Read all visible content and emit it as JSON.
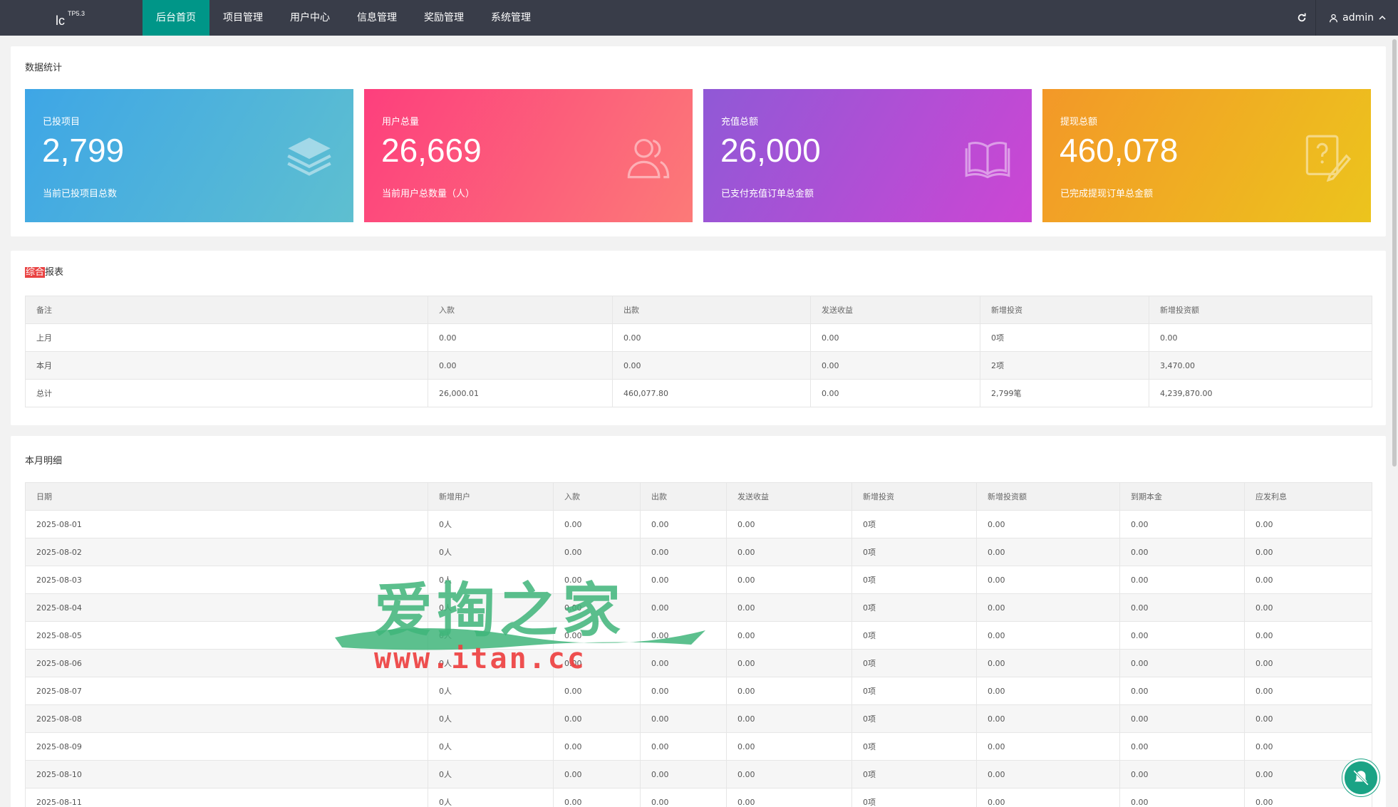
{
  "header": {
    "logo": "lc",
    "version": "TP5.3",
    "nav": [
      {
        "label": "后台首页",
        "active": true
      },
      {
        "label": "项目管理",
        "active": false
      },
      {
        "label": "用户中心",
        "active": false
      },
      {
        "label": "信息管理",
        "active": false
      },
      {
        "label": "奖励管理",
        "active": false
      },
      {
        "label": "系统管理",
        "active": false
      }
    ],
    "refresh_icon": "refresh-icon",
    "user": "admin",
    "user_icon": "user-icon",
    "caret_icon": "chevron-up-icon",
    "accent": "#009688"
  },
  "stats_section": {
    "title": "数据统计",
    "cards": [
      {
        "label": "已投项目",
        "value": "2,799",
        "desc": "当前已投项目总数",
        "icon": "layers-icon"
      },
      {
        "label": "用户总量",
        "value": "26,669",
        "desc": "当前用户总数量（人）",
        "icon": "users-icon"
      },
      {
        "label": "充值总额",
        "value": "26,000",
        "desc": "已支付充值订单总金额",
        "icon": "book-icon"
      },
      {
        "label": "提现总额",
        "value": "460,078",
        "desc": "已完成提现订单总金额",
        "icon": "help-edit-icon"
      }
    ]
  },
  "report_section": {
    "title_highlight": "综合",
    "title_rest": "报表",
    "columns": [
      "备注",
      "入款",
      "出款",
      "发送收益",
      "新增投资",
      "新增投资额"
    ],
    "rows": [
      [
        "上月",
        "0.00",
        "0.00",
        "0.00",
        "0项",
        "0.00"
      ],
      [
        "本月",
        "0.00",
        "0.00",
        "0.00",
        "2项",
        "3,470.00"
      ],
      [
        "总计",
        "26,000.01",
        "460,077.80",
        "0.00",
        "2,799笔",
        "4,239,870.00"
      ]
    ]
  },
  "monthly_section": {
    "title": "本月明细",
    "columns": [
      "日期",
      "新增用户",
      "入款",
      "出款",
      "发送收益",
      "新增投资",
      "新增投资额",
      "到期本金",
      "应发利息"
    ],
    "rows": [
      [
        "2025-08-01",
        "0人",
        "0.00",
        "0.00",
        "0.00",
        "0项",
        "0.00",
        "0.00",
        "0.00"
      ],
      [
        "2025-08-02",
        "0人",
        "0.00",
        "0.00",
        "0.00",
        "0项",
        "0.00",
        "0.00",
        "0.00"
      ],
      [
        "2025-08-03",
        "0人",
        "0.00",
        "0.00",
        "0.00",
        "0项",
        "0.00",
        "0.00",
        "0.00"
      ],
      [
        "2025-08-04",
        "0人",
        "0.00",
        "0.00",
        "0.00",
        "0项",
        "0.00",
        "0.00",
        "0.00"
      ],
      [
        "2025-08-05",
        "0人",
        "0.00",
        "0.00",
        "0.00",
        "0项",
        "0.00",
        "0.00",
        "0.00"
      ],
      [
        "2025-08-06",
        "0人",
        "0.00",
        "0.00",
        "0.00",
        "0项",
        "0.00",
        "0.00",
        "0.00"
      ],
      [
        "2025-08-07",
        "0人",
        "0.00",
        "0.00",
        "0.00",
        "0项",
        "0.00",
        "0.00",
        "0.00"
      ],
      [
        "2025-08-08",
        "0人",
        "0.00",
        "0.00",
        "0.00",
        "0项",
        "0.00",
        "0.00",
        "0.00"
      ],
      [
        "2025-08-09",
        "0人",
        "0.00",
        "0.00",
        "0.00",
        "0项",
        "0.00",
        "0.00",
        "0.00"
      ],
      [
        "2025-08-10",
        "0人",
        "0.00",
        "0.00",
        "0.00",
        "0项",
        "0.00",
        "0.00",
        "0.00"
      ],
      [
        "2025-08-11",
        "0人",
        "0.00",
        "0.00",
        "0.00",
        "0项",
        "0.00",
        "0.00",
        "0.00"
      ]
    ]
  },
  "watermark": {
    "text": "爱掏之家",
    "url": "www.itan.cc"
  },
  "float_button_icon": "bell-off-icon"
}
